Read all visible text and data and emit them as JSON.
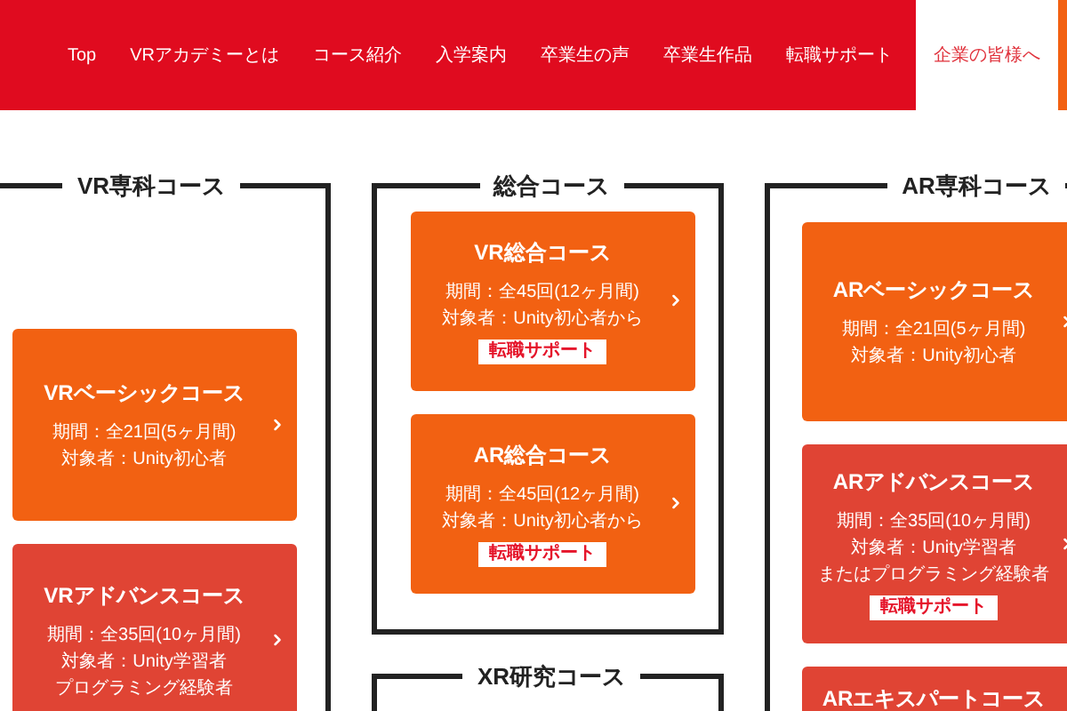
{
  "nav": {
    "items": [
      {
        "label": "Top",
        "kind": "link"
      },
      {
        "label": "VRアカデミーとは",
        "kind": "link"
      },
      {
        "label": "コース紹介",
        "kind": "link"
      },
      {
        "label": "入学案内",
        "kind": "link"
      },
      {
        "label": "卒業生の声",
        "kind": "link"
      },
      {
        "label": "卒業生作品",
        "kind": "link"
      },
      {
        "label": "転職サポート",
        "kind": "link"
      },
      {
        "label": "企業の皆様へ",
        "kind": "highlight"
      },
      {
        "kind": "accent"
      }
    ]
  },
  "columns": [
    {
      "sections": [
        {
          "title": "VR専科コース",
          "cards": [
            {
              "title": "VRベーシックコース",
              "lines": [
                "期間：全21回(5ヶ月間)",
                "対象者：Unity初心者"
              ],
              "color": "#f26112"
            },
            {
              "title": "VRアドバンスコース",
              "lines": [
                "期間：全35回(10ヶ月間)",
                "対象者：Unity学習者",
                "プログラミング経験者"
              ],
              "color": "#e04434"
            }
          ]
        }
      ]
    },
    {
      "sections": [
        {
          "title": "総合コース",
          "cards": [
            {
              "title": "VR総合コース",
              "lines": [
                "期間：全45回(12ヶ月間)",
                "対象者：Unity初心者から"
              ],
              "badge": "転職サポート",
              "color": "#f26112"
            },
            {
              "title": "AR総合コース",
              "lines": [
                "期間：全45回(12ヶ月間)",
                "対象者：Unity初心者から"
              ],
              "badge": "転職サポート",
              "color": "#f26112"
            }
          ]
        },
        {
          "title": "XR研究コース"
        }
      ]
    },
    {
      "sections": [
        {
          "title": "AR専科コース",
          "cards": [
            {
              "title": "ARベーシックコース",
              "lines": [
                "期間：全21回(5ヶ月間)",
                "対象者：Unity初心者"
              ],
              "color": "#f26112"
            },
            {
              "title": "ARアドバンスコース",
              "lines": [
                "期間：全35回(10ヶ月間)",
                "対象者：Unity学習者",
                "またはプログラミング経験者"
              ],
              "badge": "転職サポート",
              "color": "#e04434"
            },
            {
              "title": "ARエキスパートコース",
              "color": "#e04434"
            }
          ]
        }
      ]
    }
  ]
}
